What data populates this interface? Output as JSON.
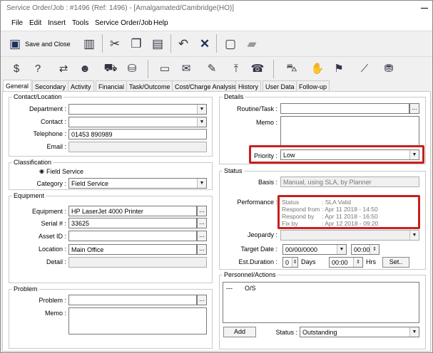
{
  "window": {
    "title": "Service Order/Job :  #1496 (Ref: 1496) - [Amalgamated/Cambridge(HO)]"
  },
  "menu": [
    "File",
    "Edit",
    "Insert",
    "Tools",
    "Service Order/Job",
    "Help"
  ],
  "toolbar": {
    "save_close_label": "Save and Close"
  },
  "tabs": [
    "General",
    "Secondary",
    "Activity",
    "Financial",
    "Task/Outcome",
    "Cost/Charge Analysis",
    "History",
    "User Data",
    "Follow-up"
  ],
  "contact": {
    "legend": "Contact/Location",
    "department_label": "Department :",
    "department_value": "",
    "contact_label": "Contact :",
    "contact_value": "",
    "telephone_label": "Telephone :",
    "telephone_value": "01453 890989",
    "email_label": "Email :",
    "email_value": ""
  },
  "classification": {
    "legend": "Classification",
    "field_service_label": "Field Service",
    "category_label": "Category :",
    "category_value": "Field Service"
  },
  "equipment": {
    "legend": "Equipment",
    "equipment_label": "Equipment :",
    "equipment_value": "HP LaserJet 4000 Printer",
    "serial_label": "Serial # :",
    "serial_value": "33625",
    "asset_label": "Asset ID :",
    "asset_value": "",
    "location_label": "Location :",
    "location_value": "Main Office",
    "detail_label": "Detail :",
    "detail_value": ""
  },
  "problem": {
    "legend": "Problem",
    "problem_label": "Problem :",
    "memo_label": "Memo :"
  },
  "details": {
    "legend": "Details",
    "routine_label": "Routine/Task :",
    "memo_label": "Memo :",
    "priority_label": "Priority :",
    "priority_value": "Low"
  },
  "status": {
    "legend": "Status",
    "basis_label": "Basis :",
    "basis_value": "Manual, using SLA, by Planner",
    "performance_label": "Performance :",
    "performance": [
      {
        "k": "Status",
        "v": ": SLA Valid"
      },
      {
        "k": "Respond from",
        "v": ": Apr 11 2018 - 14:50"
      },
      {
        "k": "Respond by",
        "v": ": Apr 11 2018 - 16:50"
      },
      {
        "k": "Fix by",
        "v": ": Apr 12 2018 - 09:20"
      }
    ],
    "jeopardy_label": "Jeopardy :",
    "target_label": "Target Date :",
    "target_date": "00/00/0000",
    "target_time": "00:00",
    "duration_label": "Est.Duration :",
    "days_value": "0",
    "days_label": "Days",
    "hrs_value": "00:00",
    "hrs_label": "Hrs",
    "set_label": "Set.."
  },
  "personnel": {
    "legend": "Personnel/Actions",
    "row_dash": "---",
    "row_status": "O/S",
    "add_label": "Add",
    "status_label": "Status :",
    "status_value": "Outstanding"
  },
  "colors": {
    "highlight": "#c8201e",
    "accent_icon": "#1f5fa8"
  }
}
